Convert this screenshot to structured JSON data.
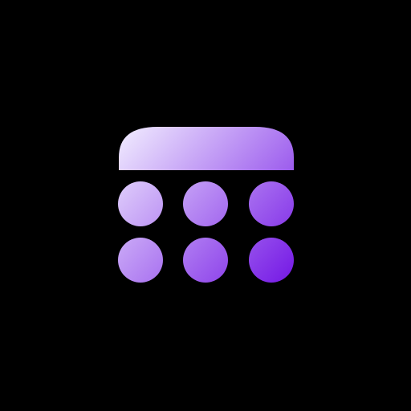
{
  "icon": {
    "name": "calendar-icon",
    "style": "gradient-glyph",
    "background_color": "#000000",
    "gradient": {
      "start_color": "#F2EEFF",
      "end_color": "#7417E5"
    },
    "parts": {
      "header": "calendar-header-bar",
      "day_rows": 2,
      "day_columns": 3
    }
  }
}
